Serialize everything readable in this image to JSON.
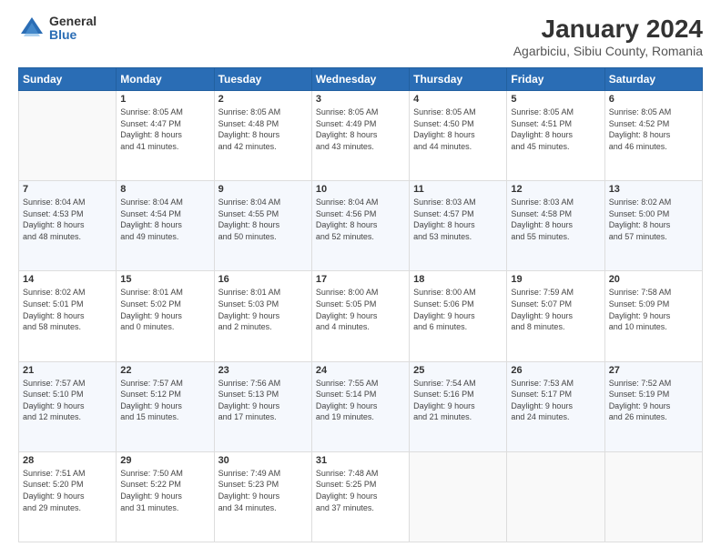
{
  "logo": {
    "general": "General",
    "blue": "Blue"
  },
  "title": "January 2024",
  "subtitle": "Agarbiciu, Sibiu County, Romania",
  "days_header": [
    "Sunday",
    "Monday",
    "Tuesday",
    "Wednesday",
    "Thursday",
    "Friday",
    "Saturday"
  ],
  "weeks": [
    [
      {
        "day": "",
        "info": ""
      },
      {
        "day": "1",
        "info": "Sunrise: 8:05 AM\nSunset: 4:47 PM\nDaylight: 8 hours\nand 41 minutes."
      },
      {
        "day": "2",
        "info": "Sunrise: 8:05 AM\nSunset: 4:48 PM\nDaylight: 8 hours\nand 42 minutes."
      },
      {
        "day": "3",
        "info": "Sunrise: 8:05 AM\nSunset: 4:49 PM\nDaylight: 8 hours\nand 43 minutes."
      },
      {
        "day": "4",
        "info": "Sunrise: 8:05 AM\nSunset: 4:50 PM\nDaylight: 8 hours\nand 44 minutes."
      },
      {
        "day": "5",
        "info": "Sunrise: 8:05 AM\nSunset: 4:51 PM\nDaylight: 8 hours\nand 45 minutes."
      },
      {
        "day": "6",
        "info": "Sunrise: 8:05 AM\nSunset: 4:52 PM\nDaylight: 8 hours\nand 46 minutes."
      }
    ],
    [
      {
        "day": "7",
        "info": "Sunrise: 8:04 AM\nSunset: 4:53 PM\nDaylight: 8 hours\nand 48 minutes."
      },
      {
        "day": "8",
        "info": "Sunrise: 8:04 AM\nSunset: 4:54 PM\nDaylight: 8 hours\nand 49 minutes."
      },
      {
        "day": "9",
        "info": "Sunrise: 8:04 AM\nSunset: 4:55 PM\nDaylight: 8 hours\nand 50 minutes."
      },
      {
        "day": "10",
        "info": "Sunrise: 8:04 AM\nSunset: 4:56 PM\nDaylight: 8 hours\nand 52 minutes."
      },
      {
        "day": "11",
        "info": "Sunrise: 8:03 AM\nSunset: 4:57 PM\nDaylight: 8 hours\nand 53 minutes."
      },
      {
        "day": "12",
        "info": "Sunrise: 8:03 AM\nSunset: 4:58 PM\nDaylight: 8 hours\nand 55 minutes."
      },
      {
        "day": "13",
        "info": "Sunrise: 8:02 AM\nSunset: 5:00 PM\nDaylight: 8 hours\nand 57 minutes."
      }
    ],
    [
      {
        "day": "14",
        "info": "Sunrise: 8:02 AM\nSunset: 5:01 PM\nDaylight: 8 hours\nand 58 minutes."
      },
      {
        "day": "15",
        "info": "Sunrise: 8:01 AM\nSunset: 5:02 PM\nDaylight: 9 hours\nand 0 minutes."
      },
      {
        "day": "16",
        "info": "Sunrise: 8:01 AM\nSunset: 5:03 PM\nDaylight: 9 hours\nand 2 minutes."
      },
      {
        "day": "17",
        "info": "Sunrise: 8:00 AM\nSunset: 5:05 PM\nDaylight: 9 hours\nand 4 minutes."
      },
      {
        "day": "18",
        "info": "Sunrise: 8:00 AM\nSunset: 5:06 PM\nDaylight: 9 hours\nand 6 minutes."
      },
      {
        "day": "19",
        "info": "Sunrise: 7:59 AM\nSunset: 5:07 PM\nDaylight: 9 hours\nand 8 minutes."
      },
      {
        "day": "20",
        "info": "Sunrise: 7:58 AM\nSunset: 5:09 PM\nDaylight: 9 hours\nand 10 minutes."
      }
    ],
    [
      {
        "day": "21",
        "info": "Sunrise: 7:57 AM\nSunset: 5:10 PM\nDaylight: 9 hours\nand 12 minutes."
      },
      {
        "day": "22",
        "info": "Sunrise: 7:57 AM\nSunset: 5:12 PM\nDaylight: 9 hours\nand 15 minutes."
      },
      {
        "day": "23",
        "info": "Sunrise: 7:56 AM\nSunset: 5:13 PM\nDaylight: 9 hours\nand 17 minutes."
      },
      {
        "day": "24",
        "info": "Sunrise: 7:55 AM\nSunset: 5:14 PM\nDaylight: 9 hours\nand 19 minutes."
      },
      {
        "day": "25",
        "info": "Sunrise: 7:54 AM\nSunset: 5:16 PM\nDaylight: 9 hours\nand 21 minutes."
      },
      {
        "day": "26",
        "info": "Sunrise: 7:53 AM\nSunset: 5:17 PM\nDaylight: 9 hours\nand 24 minutes."
      },
      {
        "day": "27",
        "info": "Sunrise: 7:52 AM\nSunset: 5:19 PM\nDaylight: 9 hours\nand 26 minutes."
      }
    ],
    [
      {
        "day": "28",
        "info": "Sunrise: 7:51 AM\nSunset: 5:20 PM\nDaylight: 9 hours\nand 29 minutes."
      },
      {
        "day": "29",
        "info": "Sunrise: 7:50 AM\nSunset: 5:22 PM\nDaylight: 9 hours\nand 31 minutes."
      },
      {
        "day": "30",
        "info": "Sunrise: 7:49 AM\nSunset: 5:23 PM\nDaylight: 9 hours\nand 34 minutes."
      },
      {
        "day": "31",
        "info": "Sunrise: 7:48 AM\nSunset: 5:25 PM\nDaylight: 9 hours\nand 37 minutes."
      },
      {
        "day": "",
        "info": ""
      },
      {
        "day": "",
        "info": ""
      },
      {
        "day": "",
        "info": ""
      }
    ]
  ]
}
